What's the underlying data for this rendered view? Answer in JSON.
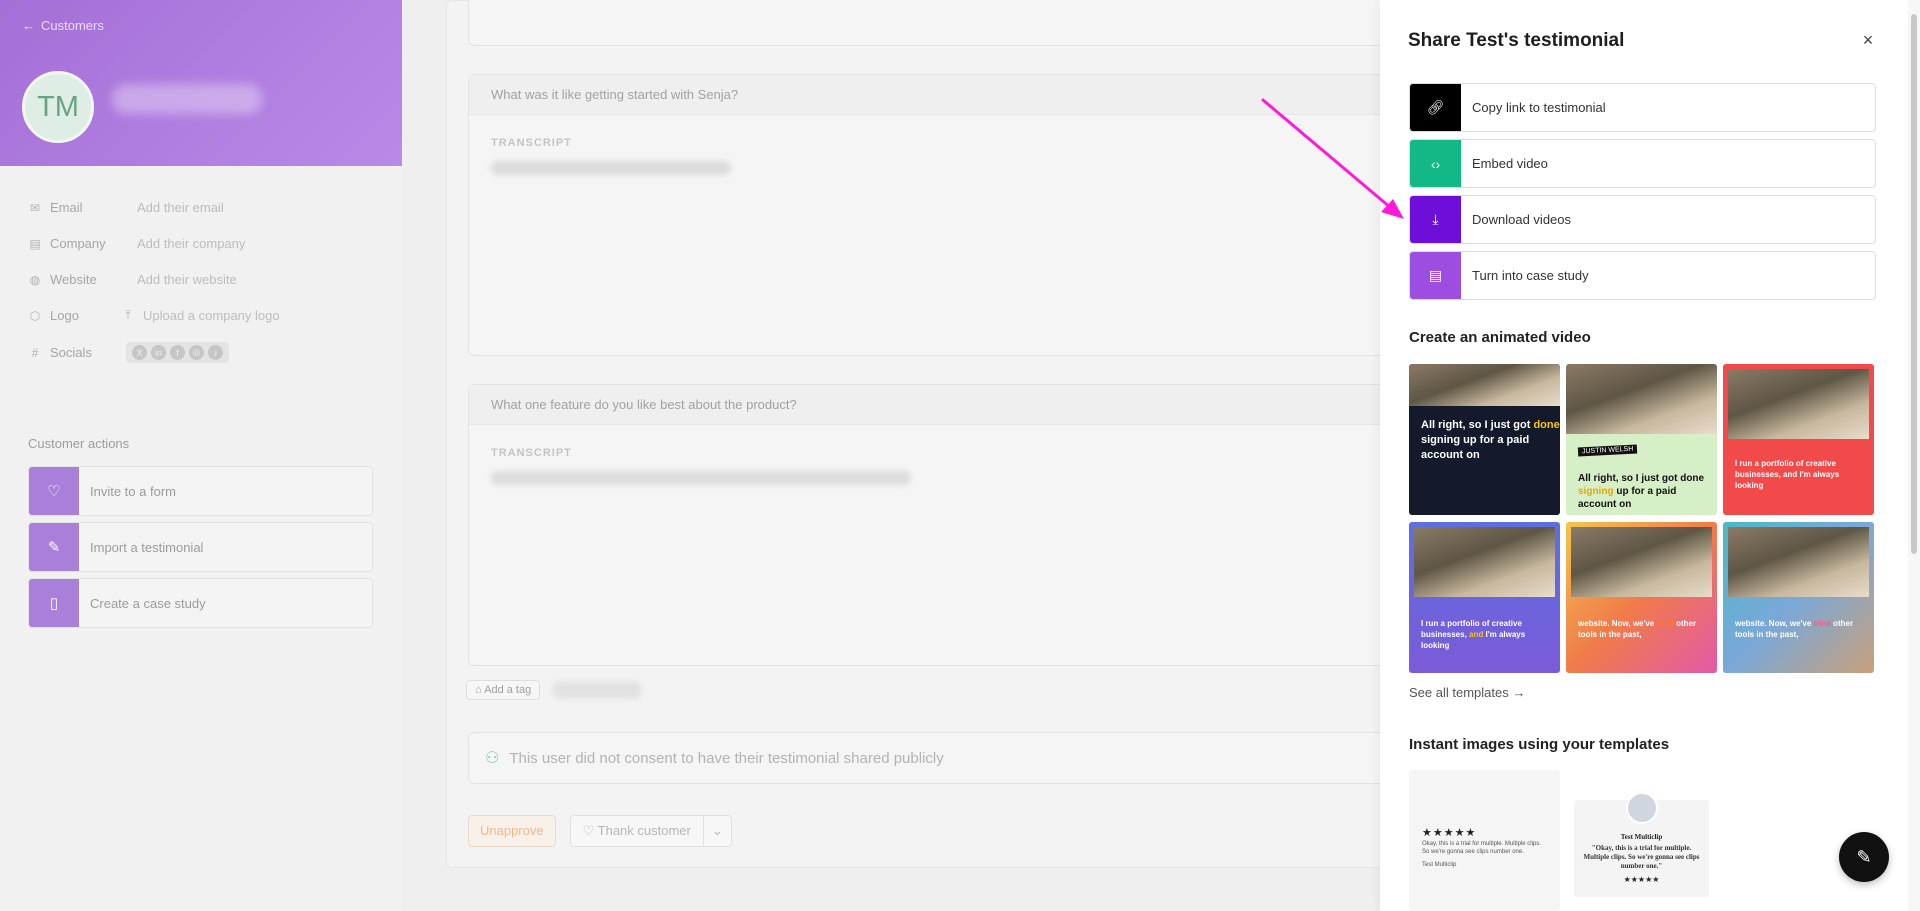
{
  "sidebar": {
    "back_label": "Customers",
    "avatar_initials": "TM",
    "fields": [
      {
        "icon": "mail-icon",
        "label": "Email",
        "value": "Add their email"
      },
      {
        "icon": "building-icon",
        "label": "Company",
        "value": "Add their company"
      },
      {
        "icon": "globe-icon",
        "label": "Website",
        "value": "Add their website"
      },
      {
        "icon": "hexagon-icon",
        "label": "Logo",
        "value": "Upload a company logo"
      },
      {
        "icon": "hash-icon",
        "label": "Socials",
        "value": ""
      }
    ],
    "actions_title": "Customer actions",
    "actions": [
      {
        "icon": "heart-icon",
        "label": "Invite to a form"
      },
      {
        "icon": "pencil-icon",
        "label": "Import a testimonial"
      },
      {
        "icon": "book-icon",
        "label": "Create a case study"
      }
    ]
  },
  "main": {
    "questions": [
      {
        "question": "What was it like getting started with Senja?",
        "transcript_label": "TRANSCRIPT"
      },
      {
        "question": "What one feature do you like best about the product?",
        "transcript_label": "TRANSCRIPT"
      }
    ],
    "add_tag": "Add a tag",
    "consent_text": "This user did not consent to have their testimonial shared publicly",
    "unapprove": "Unapprove",
    "thank_customer": "Thank customer"
  },
  "panel": {
    "title": "Share Test's testimonial",
    "options": [
      {
        "label": "Copy link to testimonial",
        "icon": "link-icon",
        "color": "#000000"
      },
      {
        "label": "Embed video",
        "icon": "code-icon",
        "color": "#12b886"
      },
      {
        "label": "Download videos",
        "icon": "download-icon",
        "color": "#6d0fd8"
      },
      {
        "label": "Turn into case study",
        "icon": "document-icon",
        "color": "#9b4ee0"
      }
    ],
    "animated_title": "Create an animated video",
    "tile1": {
      "pre": "All right, so I just got ",
      "hl": "done",
      "post": " signing up for a paid account on"
    },
    "tile2": {
      "badge": "JUSTIN WELSH",
      "pre": "All right, so I just got done ",
      "hl": "signing",
      "post": " up for a paid account on"
    },
    "tile3": {
      "text": "I run a portfolio of creative businesses, and I'm always looking"
    },
    "tile4": {
      "pre": "I run a portfolio of creative businesses, ",
      "hl": "and",
      "post": " I'm always looking"
    },
    "tile5": {
      "pre": "website. Now, we've ",
      "hl": "tried",
      "post": " other tools in the past,"
    },
    "tile6": {
      "pre": "website. Now, we've ",
      "hl": "tried",
      "post": " other tools in the past,"
    },
    "see_all": "See all templates",
    "instant_title": "Instant images using your templates",
    "img1": {
      "stars": "★★★★★",
      "text": "Okay, this is a trial for multiple. Multiple clips. So we're gonna see clips number one.",
      "who": "Test Multiclip"
    },
    "img2": {
      "name": "Test Multiclip",
      "quote": "\"Okay, this is a trial for multiple. Multiple clips. So we're gonna see clips number one.\"",
      "stars": "★★★★★"
    }
  },
  "colors": {
    "accent": "#6d0fd8",
    "arrow": "#ff1ad9",
    "green": "#12b886"
  }
}
